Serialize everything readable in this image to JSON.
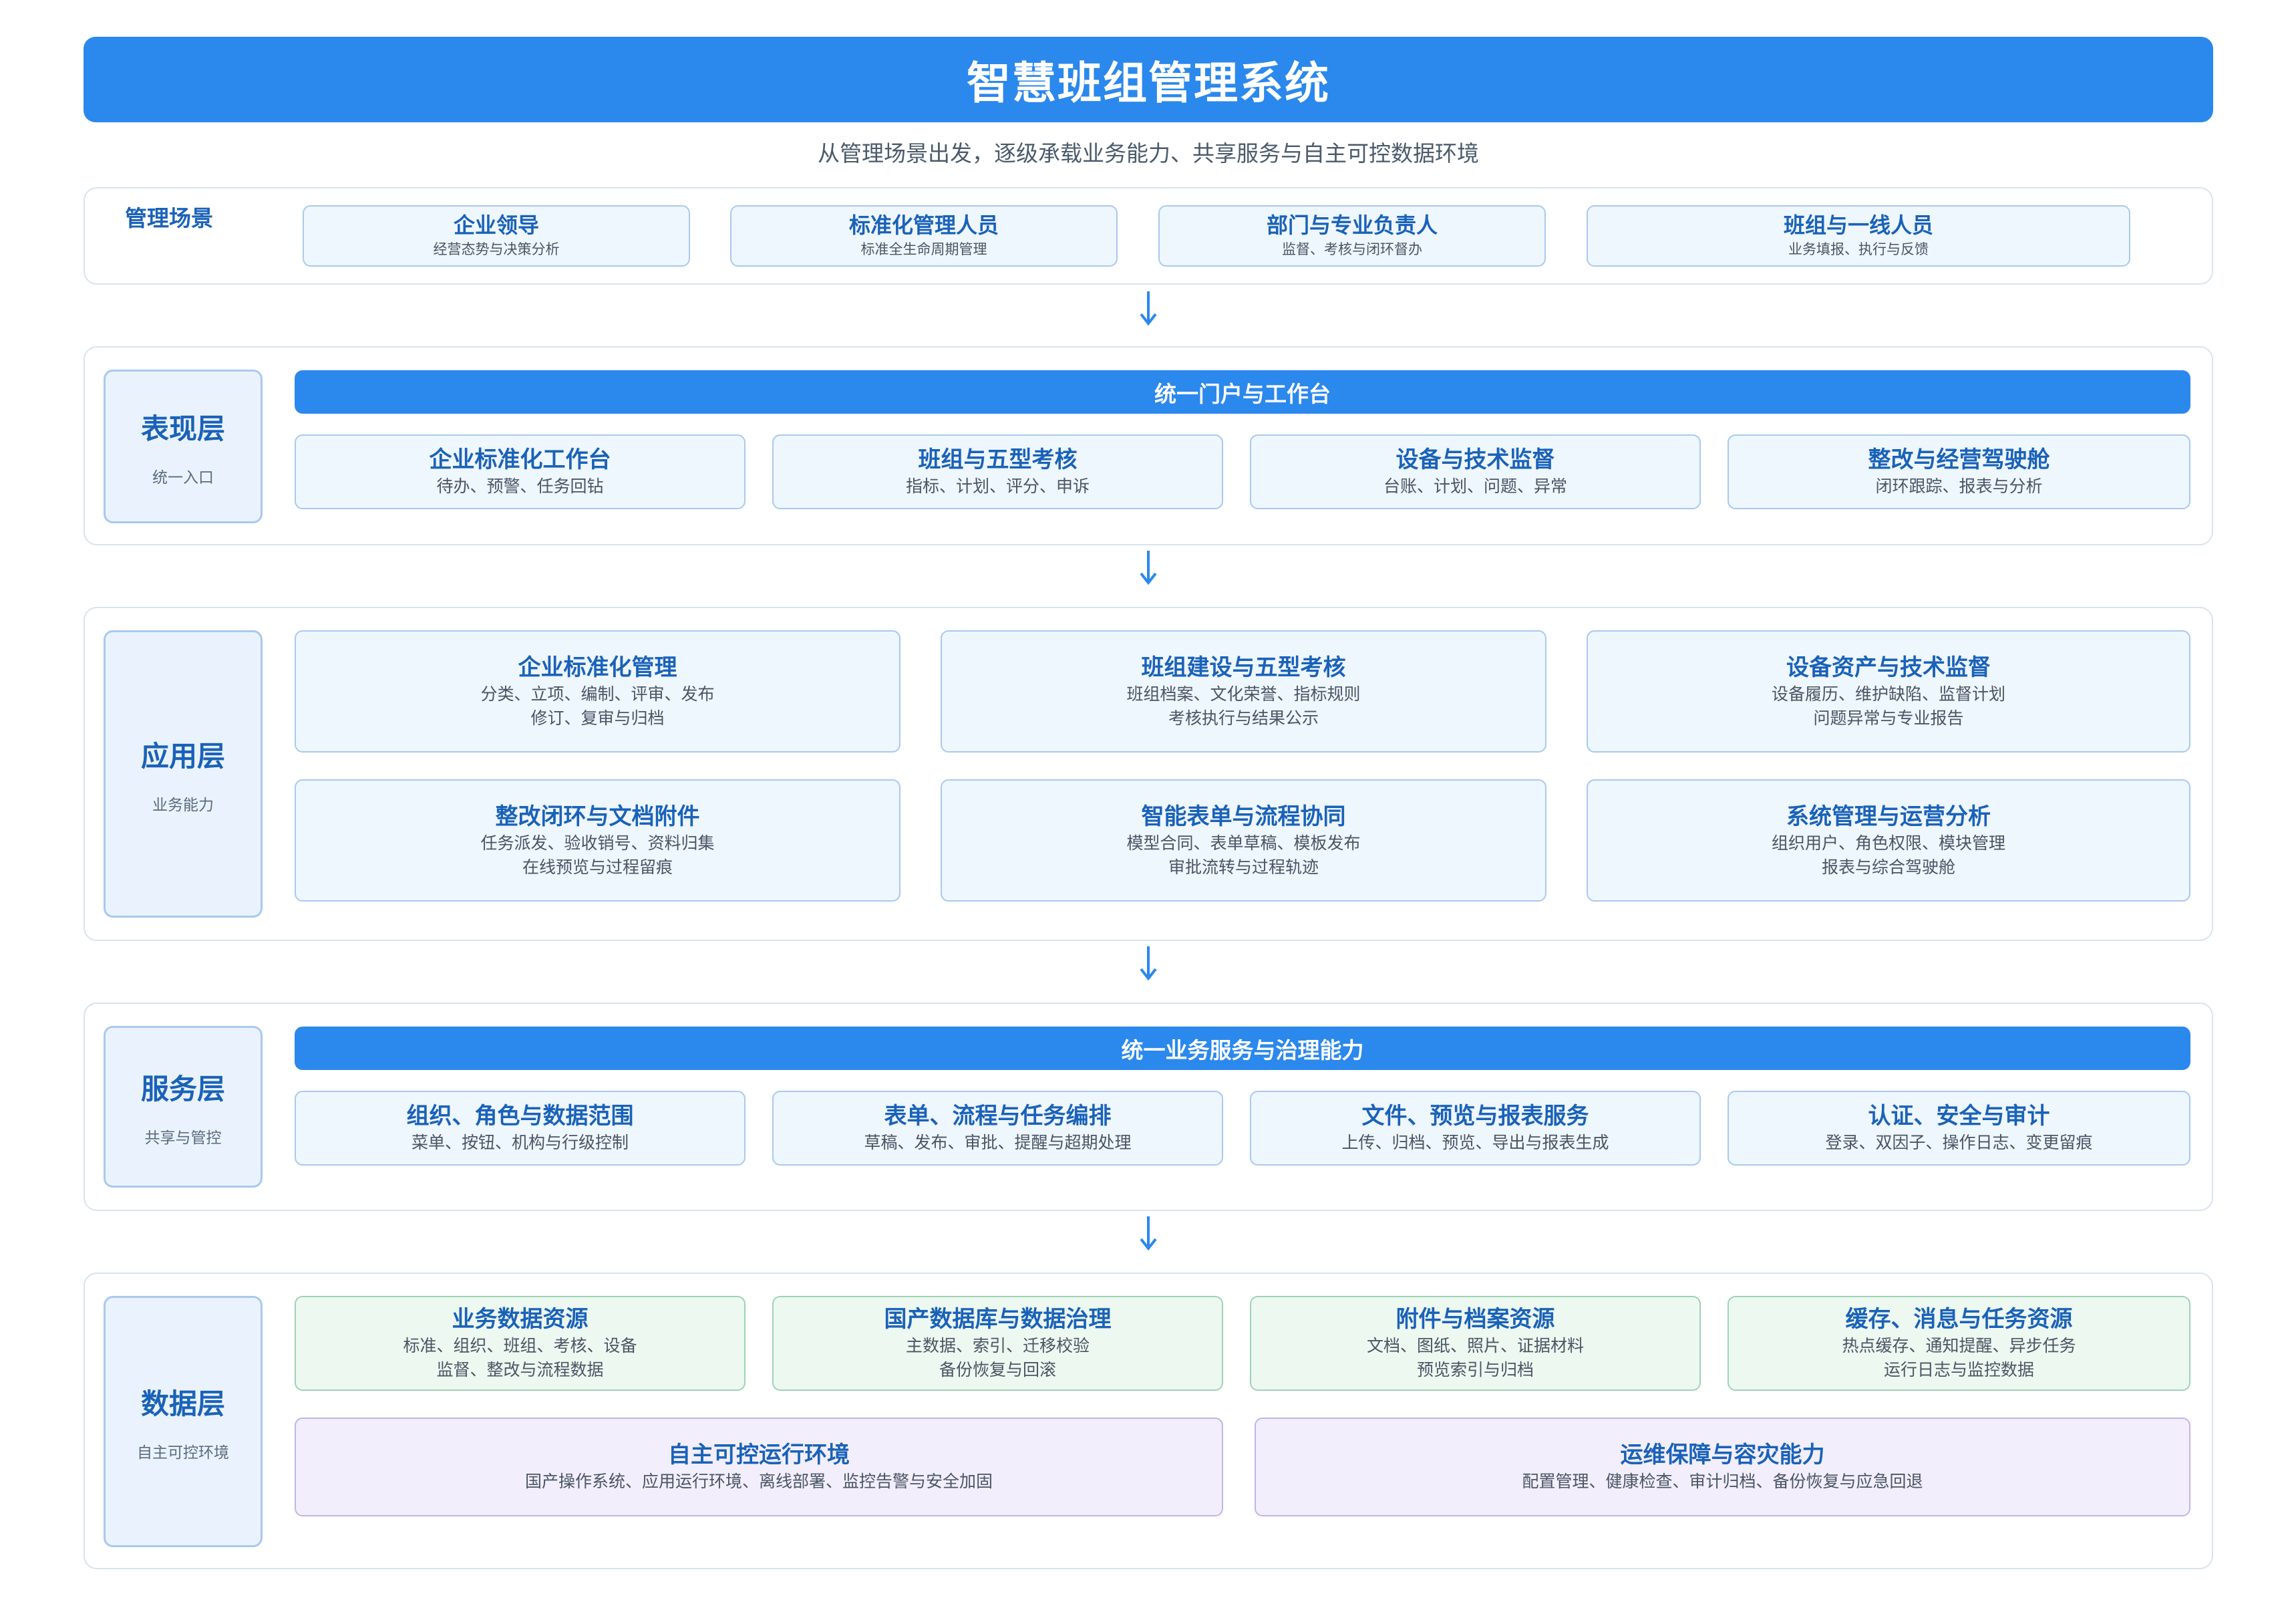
{
  "title": "智慧班组管理系统",
  "subtitle": "从管理场景出发，逐级承载业务能力、共享服务与自主可控数据环境",
  "scenes": {
    "label": "管理场景",
    "items": [
      {
        "title": "企业领导",
        "desc": "经营态势与决策分析"
      },
      {
        "title": "标准化管理人员",
        "desc": "标准全生命周期管理"
      },
      {
        "title": "部门与专业负责人",
        "desc": "监督、考核与闭环督办"
      },
      {
        "title": "班组与一线人员",
        "desc": "业务填报、执行与反馈"
      }
    ]
  },
  "presentation": {
    "label": "表现层",
    "sub": "统一入口",
    "banner": "统一门户与工作台",
    "items": [
      {
        "title": "企业标准化工作台",
        "desc": "待办、预警、任务回钻"
      },
      {
        "title": "班组与五型考核",
        "desc": "指标、计划、评分、申诉"
      },
      {
        "title": "设备与技术监督",
        "desc": "台账、计划、问题、异常"
      },
      {
        "title": "整改与经营驾驶舱",
        "desc": "闭环跟踪、报表与分析"
      }
    ]
  },
  "application": {
    "label": "应用层",
    "sub": "业务能力",
    "items": [
      {
        "title": "企业标准化管理",
        "l1": "分类、立项、编制、评审、发布",
        "l2": "修订、复审与归档"
      },
      {
        "title": "班组建设与五型考核",
        "l1": "班组档案、文化荣誉、指标规则",
        "l2": "考核执行与结果公示"
      },
      {
        "title": "设备资产与技术监督",
        "l1": "设备履历、维护缺陷、监督计划",
        "l2": "问题异常与专业报告"
      },
      {
        "title": "整改闭环与文档附件",
        "l1": "任务派发、验收销号、资料归集",
        "l2": "在线预览与过程留痕"
      },
      {
        "title": "智能表单与流程协同",
        "l1": "模型合同、表单草稿、模板发布",
        "l2": "审批流转与过程轨迹"
      },
      {
        "title": "系统管理与运营分析",
        "l1": "组织用户、角色权限、模块管理",
        "l2": "报表与综合驾驶舱"
      }
    ]
  },
  "service": {
    "label": "服务层",
    "sub": "共享与管控",
    "banner": "统一业务服务与治理能力",
    "items": [
      {
        "title": "组织、角色与数据范围",
        "desc": "菜单、按钮、机构与行级控制"
      },
      {
        "title": "表单、流程与任务编排",
        "desc": "草稿、发布、审批、提醒与超期处理"
      },
      {
        "title": "文件、预览与报表服务",
        "desc": "上传、归档、预览、导出与报表生成"
      },
      {
        "title": "认证、安全与审计",
        "desc": "登录、双因子、操作日志、变更留痕"
      }
    ]
  },
  "data_layer": {
    "label": "数据层",
    "sub": "自主可控环境",
    "items": [
      {
        "title": "业务数据资源",
        "l1": "标准、组织、班组、考核、设备",
        "l2": "监督、整改与流程数据"
      },
      {
        "title": "国产数据库与数据治理",
        "l1": "主数据、索引、迁移校验",
        "l2": "备份恢复与回滚"
      },
      {
        "title": "附件与档案资源",
        "l1": "文档、图纸、照片、证据材料",
        "l2": "预览索引与归档"
      },
      {
        "title": "缓存、消息与任务资源",
        "l1": "热点缓存、通知提醒、异步任务",
        "l2": "运行日志与监控数据"
      }
    ],
    "wide": [
      {
        "title": "自主可控运行环境",
        "desc": "国产操作系统、应用运行环境、离线部署、监控告警与安全加固"
      },
      {
        "title": "运维保障与容灾能力",
        "desc": "配置管理、健康检查、审计归档、备份恢复与应急回退"
      }
    ]
  },
  "colors": {
    "primary": "#2b88ec",
    "label_text": "#1a62b8",
    "card_bg": "#eef6fe",
    "card_border": "#a9c9ee",
    "green_border": "#9ed3b4",
    "purple_border": "#c2b4e8"
  }
}
